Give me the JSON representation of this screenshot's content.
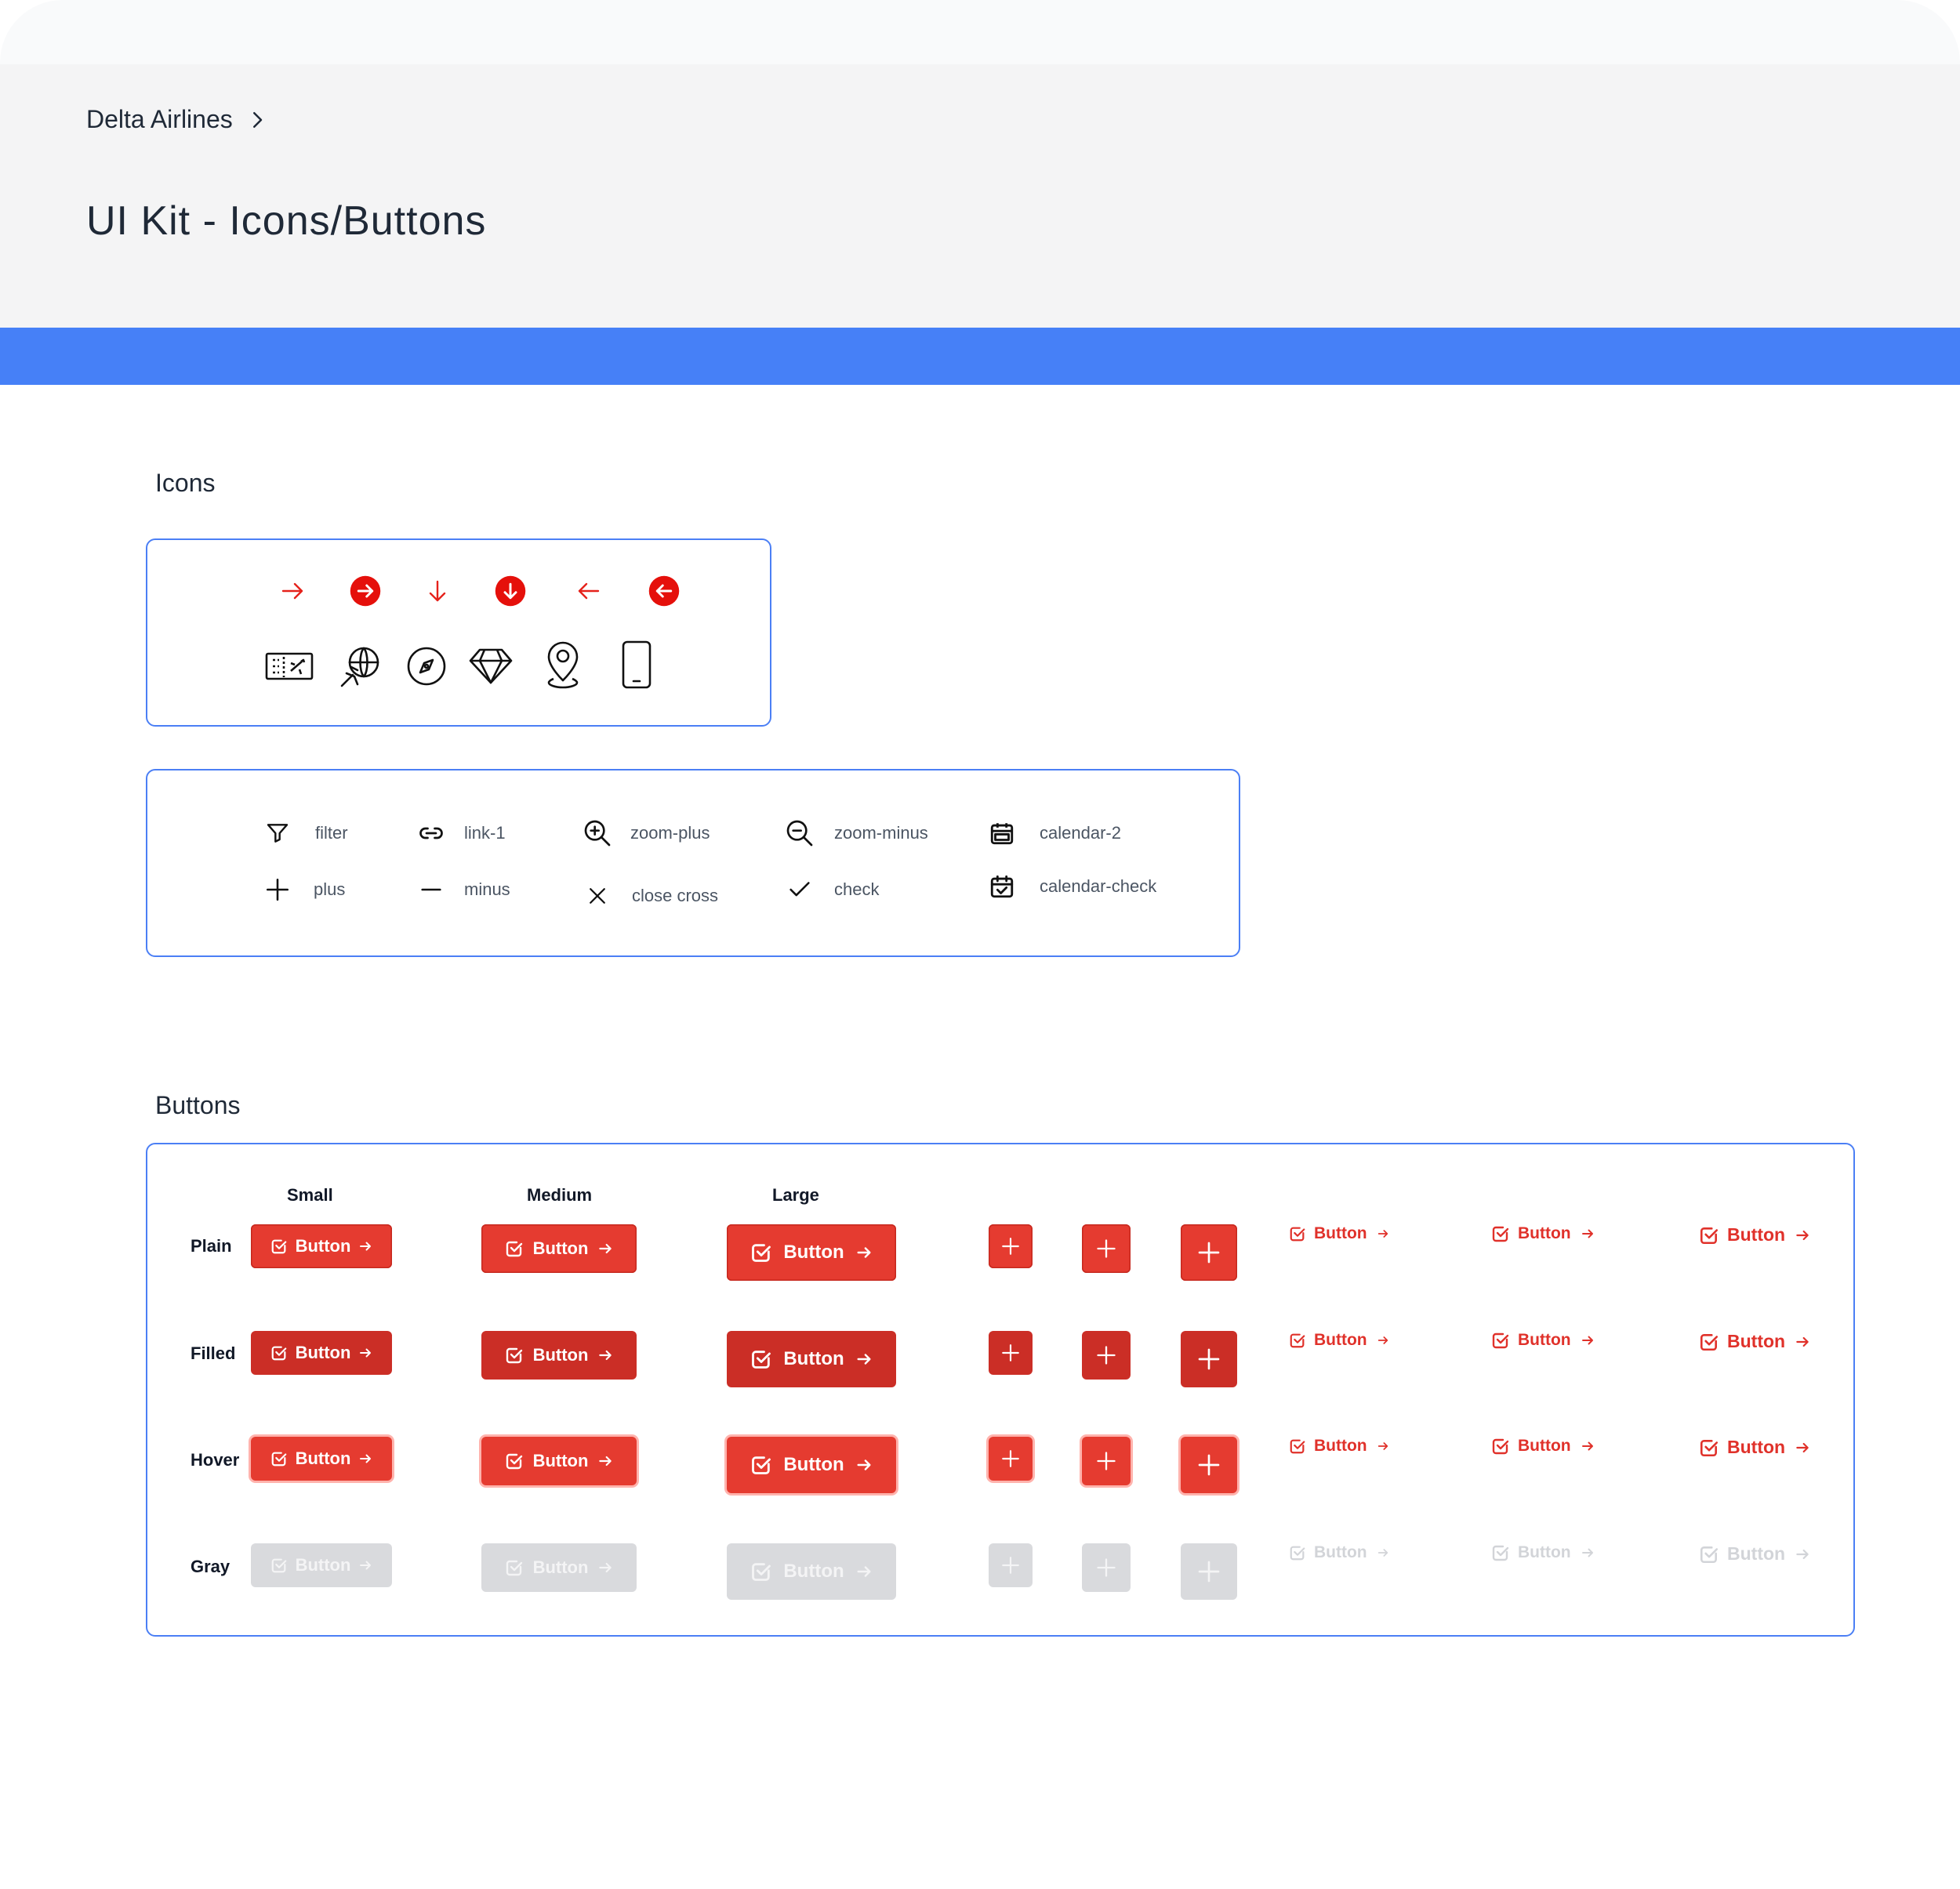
{
  "header": {
    "breadcrumb": "Delta Airlines",
    "title": "UI Kit - Icons/Buttons"
  },
  "colors": {
    "accent_blue": "#4680f7",
    "red": "#e53b30",
    "red_dark": "#cb2e26",
    "gray": "#d9dadd"
  },
  "icons_section": {
    "title": "Icons",
    "row1": [
      "arrow-right-icon",
      "arrow-right-circle-icon",
      "arrow-down-icon",
      "arrow-down-circle-icon",
      "arrow-left-icon",
      "arrow-left-circle-icon"
    ],
    "row2": [
      "ticket-icon",
      "globe-plane-icon",
      "compass-icon",
      "diamond-icon",
      "map-pin-icon",
      "tablet-icon"
    ],
    "legend": [
      {
        "icon": "filter-icon",
        "label": "filter"
      },
      {
        "icon": "link-icon",
        "label": "link-1"
      },
      {
        "icon": "zoom-plus-icon",
        "label": "zoom-plus"
      },
      {
        "icon": "zoom-minus-icon",
        "label": "zoom-minus"
      },
      {
        "icon": "calendar-icon",
        "label": "calendar-2"
      },
      {
        "icon": "plus-icon",
        "label": "plus"
      },
      {
        "icon": "minus-icon",
        "label": "minus"
      },
      {
        "icon": "close-icon",
        "label": "close cross"
      },
      {
        "icon": "check-icon",
        "label": "check"
      },
      {
        "icon": "calendar-check-icon",
        "label": "calendar-check"
      }
    ]
  },
  "buttons_section": {
    "title": "Buttons",
    "columns": [
      "Small",
      "Medium",
      "Large"
    ],
    "rows": [
      "Plain",
      "Filled",
      "Hover",
      "Gray"
    ],
    "button_label": "Button"
  }
}
